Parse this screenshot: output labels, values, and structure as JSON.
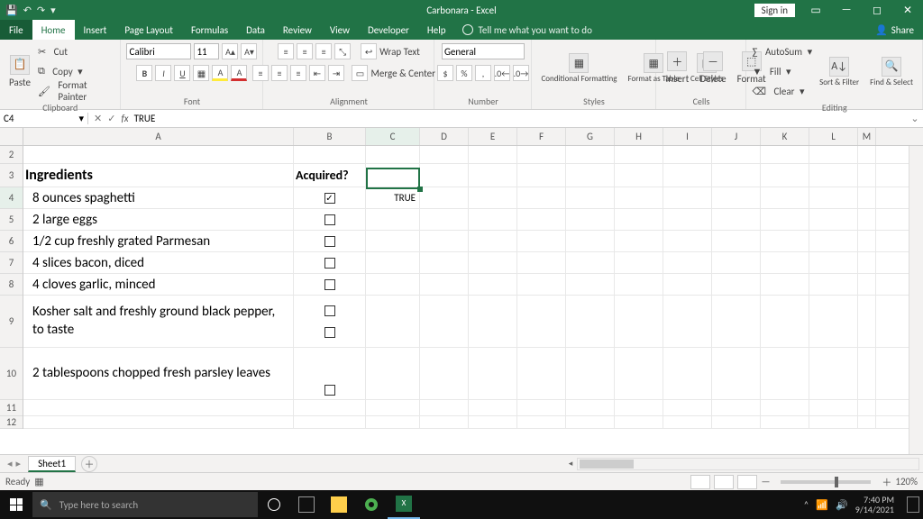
{
  "titlebar": {
    "doc_title": "Carbonara - Excel",
    "signin": "Sign in"
  },
  "tabs": {
    "file": "File",
    "list": [
      "Home",
      "Insert",
      "Page Layout",
      "Formulas",
      "Data",
      "Review",
      "View",
      "Developer",
      "Help"
    ],
    "active": "Home",
    "tell_me": "Tell me what you want to do",
    "share": "Share"
  },
  "ribbon": {
    "clipboard": {
      "label": "Clipboard",
      "paste": "Paste",
      "cut": "Cut",
      "copy": "Copy",
      "format_painter": "Format Painter"
    },
    "font": {
      "label": "Font",
      "name": "Calibri",
      "size": "11"
    },
    "alignment": {
      "label": "Alignment",
      "wrap": "Wrap Text",
      "merge": "Merge & Center"
    },
    "number": {
      "label": "Number",
      "format": "General"
    },
    "styles": {
      "label": "Styles",
      "cond": "Conditional Formatting",
      "table": "Format as Table",
      "cell": "Cell Styles"
    },
    "cells": {
      "label": "Cells",
      "insert": "Insert",
      "delete": "Delete",
      "format": "Format"
    },
    "editing": {
      "label": "Editing",
      "autosum": "AutoSum",
      "fill": "Fill",
      "clear": "Clear",
      "sort": "Sort & Filter",
      "find": "Find & Select"
    }
  },
  "namebox": "C4",
  "formula_bar": "TRUE",
  "columns": [
    "A",
    "B",
    "C",
    "D",
    "E",
    "F",
    "G",
    "H",
    "I",
    "J",
    "K",
    "L",
    "M"
  ],
  "rows_visible": [
    "2",
    "3",
    "4",
    "5",
    "6",
    "7",
    "8",
    "9",
    "10",
    "11",
    "12"
  ],
  "sheet": {
    "header_ingredients": "Ingredients",
    "header_acquired": "Acquired?",
    "items": [
      {
        "text": "8 ounces spaghetti",
        "checked": true
      },
      {
        "text": "2 large eggs",
        "checked": false
      },
      {
        "text": "1/2 cup freshly grated Parmesan",
        "checked": false
      },
      {
        "text": "4 slices bacon, diced",
        "checked": false
      },
      {
        "text": "4 cloves garlic, minced",
        "checked": false
      },
      {
        "text": "Kosher salt and freshly ground black pepper, to taste",
        "checked": false,
        "double_cb": true,
        "tall": true
      },
      {
        "text": "2 tablespoons chopped fresh parsley leaves",
        "checked": false,
        "tall": true
      }
    ],
    "c4_value": "TRUE"
  },
  "sheet_tabs": {
    "name": "Sheet1"
  },
  "statusbar": {
    "ready": "Ready",
    "zoom": "120%"
  },
  "taskbar": {
    "search_placeholder": "Type here to search",
    "time": "7:40 PM",
    "date": "9/14/2021"
  }
}
